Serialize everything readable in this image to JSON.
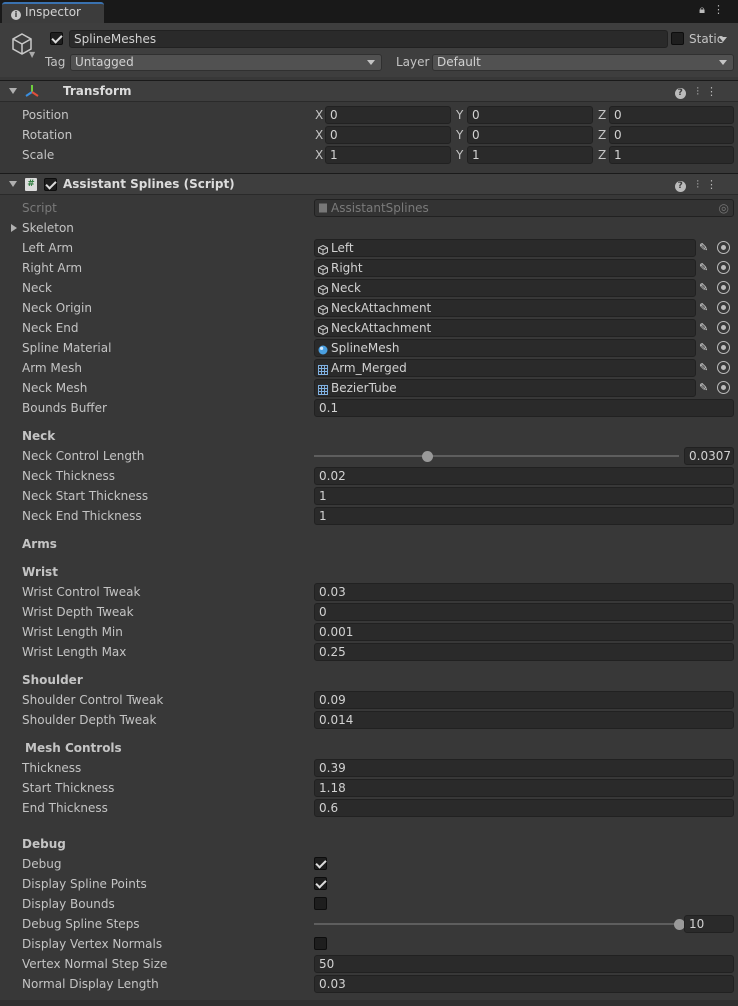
{
  "tab": {
    "title": "Inspector"
  },
  "gameobject": {
    "name": "SplineMeshes",
    "static_label": "Static",
    "tag_label": "Tag",
    "tag_value": "Untagged",
    "layer_label": "Layer",
    "layer_value": "Default"
  },
  "transform": {
    "title": "Transform",
    "rows": [
      {
        "label": "Position",
        "x": "0",
        "y": "0",
        "z": "0"
      },
      {
        "label": "Rotation",
        "x": "0",
        "y": "0",
        "z": "0"
      },
      {
        "label": "Scale",
        "x": "1",
        "y": "1",
        "z": "1"
      }
    ],
    "axis": {
      "x": "X",
      "y": "Y",
      "z": "Z"
    }
  },
  "script": {
    "title": "Assistant Splines (Script)",
    "script_label": "Script",
    "script_value": "AssistantSplines",
    "skeleton_label": "Skeleton",
    "refs": [
      {
        "label": "Left Arm",
        "value": "Left",
        "icon": "cube-icon"
      },
      {
        "label": "Right Arm",
        "value": "Right",
        "icon": "cube-icon"
      },
      {
        "label": "Neck",
        "value": "Neck",
        "icon": "cube-icon"
      },
      {
        "label": "Neck Origin",
        "value": "NeckAttachment",
        "icon": "cube-icon"
      },
      {
        "label": "Neck End",
        "value": "NeckAttachment",
        "icon": "cube-icon"
      },
      {
        "label": "Spline Material",
        "value": "SplineMesh",
        "icon": "material-icon"
      },
      {
        "label": "Arm Mesh",
        "value": "Arm_Merged",
        "icon": "mesh-icon"
      },
      {
        "label": "Neck Mesh",
        "value": "BezierTube",
        "icon": "mesh-icon"
      }
    ],
    "bounds_buffer": {
      "label": "Bounds Buffer",
      "value": "0.1"
    },
    "neck": {
      "header": "Neck",
      "control_length": {
        "label": "Neck Control Length",
        "value": "0.0307",
        "fraction": 0.31
      },
      "fields": [
        {
          "label": "Neck Thickness",
          "value": "0.02"
        },
        {
          "label": "Neck Start Thickness",
          "value": "1"
        },
        {
          "label": "Neck End Thickness",
          "value": "1"
        }
      ]
    },
    "arms_header": "Arms",
    "wrist": {
      "header": "Wrist",
      "fields": [
        {
          "label": "Wrist Control Tweak",
          "value": "0.03"
        },
        {
          "label": "Wrist Depth Tweak",
          "value": "0"
        },
        {
          "label": "Wrist Length Min",
          "value": "0.001"
        },
        {
          "label": "Wrist Length Max",
          "value": "0.25"
        }
      ]
    },
    "shoulder": {
      "header": "Shoulder",
      "fields": [
        {
          "label": "Shoulder Control Tweak",
          "value": "0.09"
        },
        {
          "label": "Shoulder Depth Tweak",
          "value": "0.014"
        }
      ]
    },
    "mesh_controls": {
      "header": "Mesh Controls",
      "fields": [
        {
          "label": "Thickness",
          "value": "0.39"
        },
        {
          "label": "Start Thickness",
          "value": "1.18"
        },
        {
          "label": "End Thickness",
          "value": "0.6"
        }
      ]
    },
    "debug": {
      "header": "Debug",
      "debug": {
        "label": "Debug",
        "checked": true
      },
      "display_spline_points": {
        "label": "Display Spline Points",
        "checked": true
      },
      "display_bounds": {
        "label": "Display Bounds",
        "checked": false
      },
      "spline_steps": {
        "label": "Debug Spline Steps",
        "value": "10",
        "fraction": 1.0
      },
      "display_vertex_normals": {
        "label": "Display Vertex Normals",
        "checked": false
      },
      "vertex_normal_step": {
        "label": "Vertex Normal Step Size",
        "value": "50"
      },
      "normal_display_length": {
        "label": "Normal Display Length",
        "value": "0.03"
      }
    }
  }
}
